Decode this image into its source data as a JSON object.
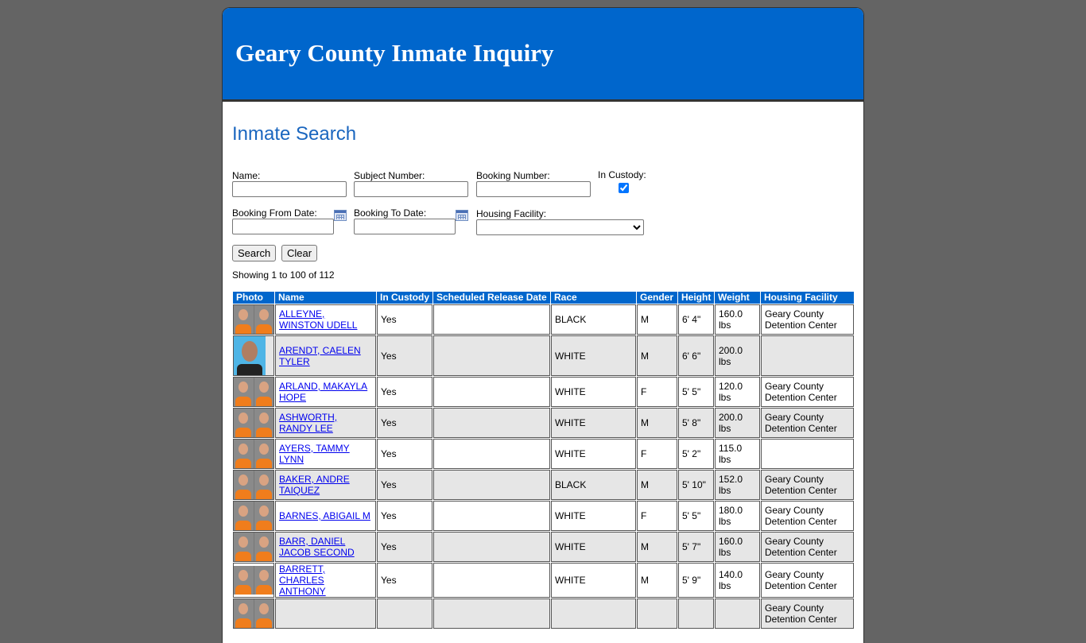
{
  "header": {
    "title": "Geary County Inmate Inquiry"
  },
  "search": {
    "title": "Inmate Search",
    "name_label": "Name:",
    "subject_label": "Subject Number:",
    "booking_label": "Booking Number:",
    "custody_label": "In Custody:",
    "custody_checked": true,
    "from_label": "Booking From Date:",
    "to_label": "Booking To Date:",
    "facility_label": "Housing Facility:",
    "search_button": "Search",
    "clear_button": "Clear"
  },
  "results": {
    "showing": "Showing 1 to 100 of 112",
    "columns": [
      "Photo",
      "Name",
      "In Custody",
      "Scheduled Release Date",
      "Race",
      "Gender",
      "Height",
      "Weight",
      "Housing Facility"
    ],
    "rows": [
      {
        "name": "ALLEYNE, WINSTON UDELL",
        "custody": "Yes",
        "release": "",
        "race": "BLACK",
        "gender": "M",
        "height": "6' 4\"",
        "weight": "160.0 lbs",
        "facility": "Geary County Detention Center"
      },
      {
        "name": "ARENDT, CAELEN TYLER",
        "custody": "Yes",
        "release": "",
        "race": "WHITE",
        "gender": "M",
        "height": "6' 6\"",
        "weight": "200.0 lbs",
        "facility": ""
      },
      {
        "name": "ARLAND, MAKAYLA HOPE",
        "custody": "Yes",
        "release": "",
        "race": "WHITE",
        "gender": "F",
        "height": "5' 5\"",
        "weight": "120.0 lbs",
        "facility": "Geary County Detention Center"
      },
      {
        "name": "ASHWORTH, RANDY LEE",
        "custody": "Yes",
        "release": "",
        "race": "WHITE",
        "gender": "M",
        "height": "5' 8\"",
        "weight": "200.0 lbs",
        "facility": "Geary County Detention Center"
      },
      {
        "name": "AYERS, TAMMY LYNN",
        "custody": "Yes",
        "release": "",
        "race": "WHITE",
        "gender": "F",
        "height": "5' 2\"",
        "weight": "115.0 lbs",
        "facility": ""
      },
      {
        "name": "BAKER, ANDRE TAIQUEZ",
        "custody": "Yes",
        "release": "",
        "race": "BLACK",
        "gender": "M",
        "height": "5' 10\"",
        "weight": "152.0 lbs",
        "facility": "Geary County Detention Center"
      },
      {
        "name": "BARNES, ABIGAIL M",
        "custody": "Yes",
        "release": "",
        "race": "WHITE",
        "gender": "F",
        "height": "5' 5\"",
        "weight": "180.0 lbs",
        "facility": "Geary County Detention Center"
      },
      {
        "name": "BARR, DANIEL JACOB SECOND",
        "custody": "Yes",
        "release": "",
        "race": "WHITE",
        "gender": "M",
        "height": "5' 7\"",
        "weight": "160.0 lbs",
        "facility": "Geary County Detention Center"
      },
      {
        "name": "BARRETT, CHARLES ANTHONY",
        "custody": "Yes",
        "release": "",
        "race": "WHITE",
        "gender": "M",
        "height": "5' 9\"",
        "weight": "140.0 lbs",
        "facility": "Geary County Detention Center"
      },
      {
        "name": "",
        "custody": "",
        "release": "",
        "race": "",
        "gender": "",
        "height": "",
        "weight": "",
        "facility": "Geary County Detention Center"
      }
    ]
  }
}
